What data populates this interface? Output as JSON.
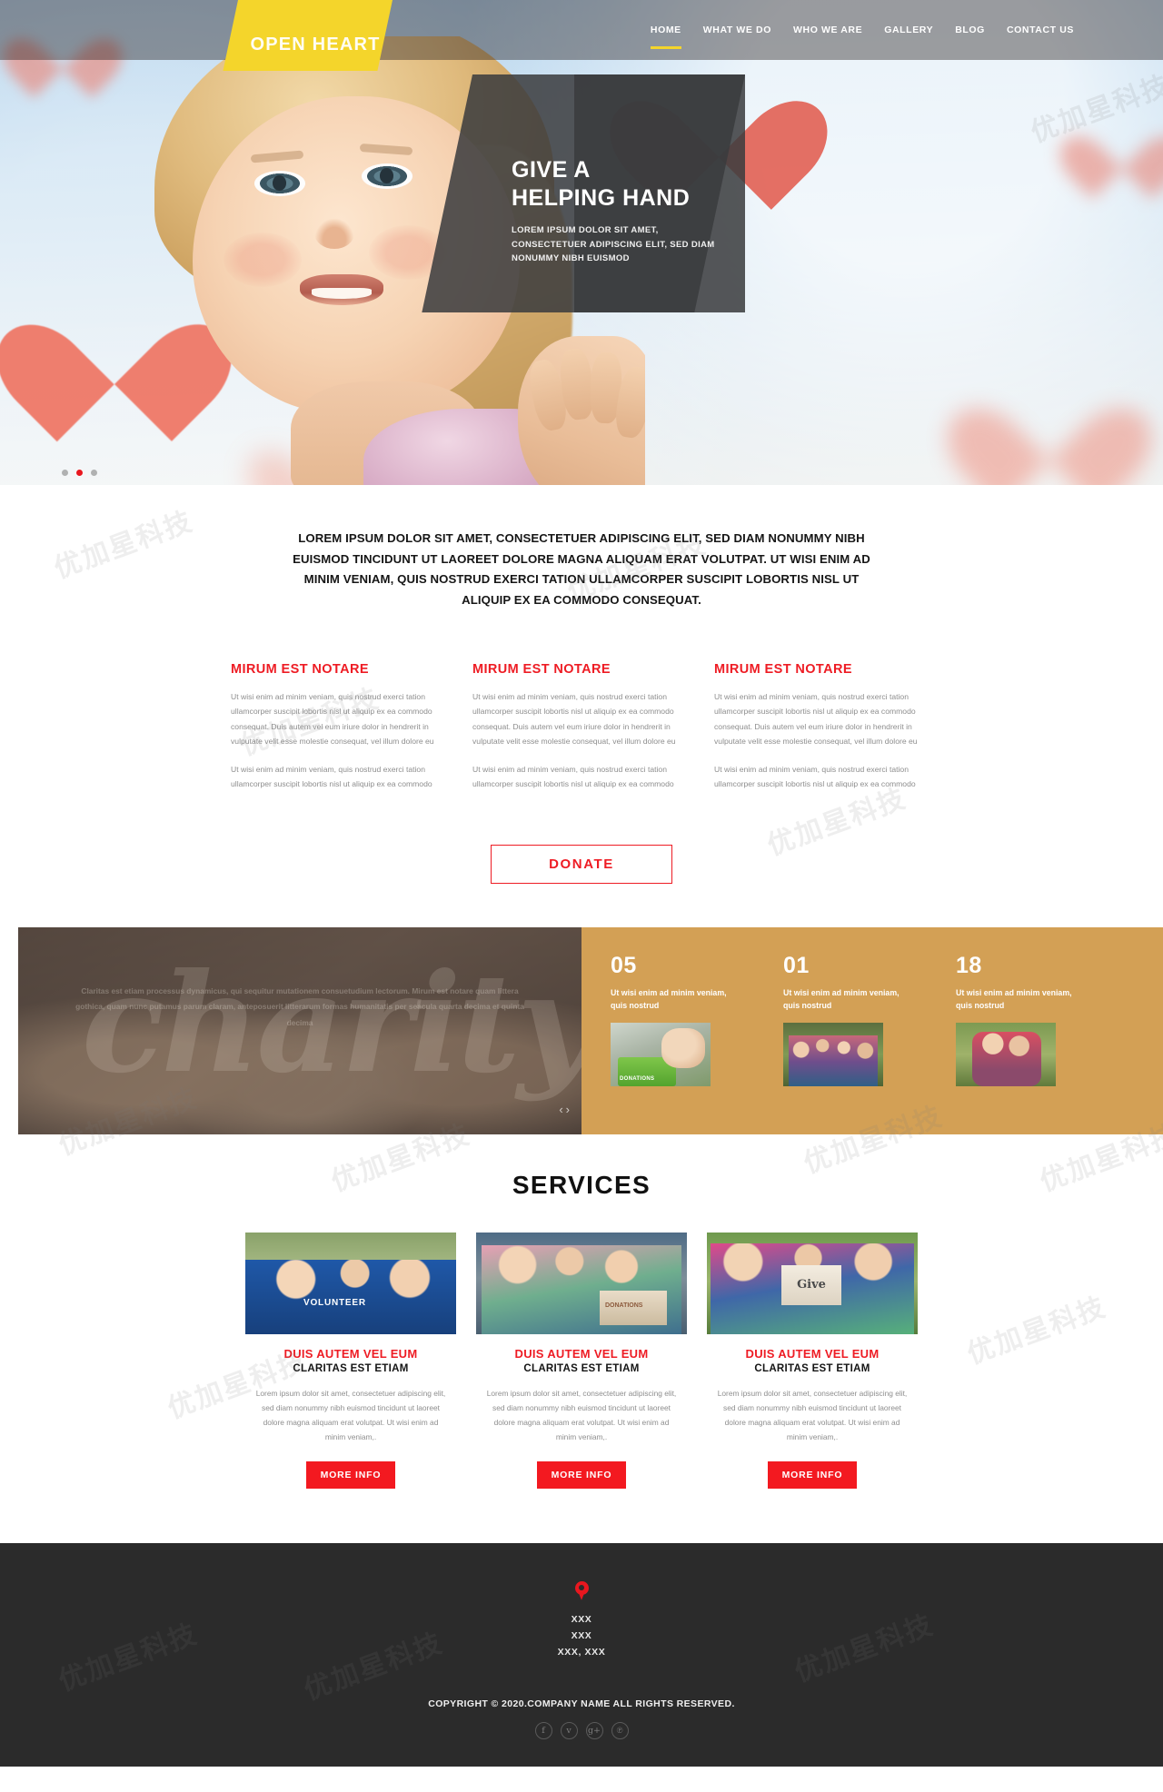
{
  "brand": {
    "name": "OPEN HEART",
    "heart_icon": "heart-icon",
    "logo_bg": "#F4D52B",
    "accent_red": "#EE1C24",
    "accent_gold": "#D3A055"
  },
  "nav": {
    "items": [
      {
        "label": "HOME",
        "active": true
      },
      {
        "label": "WHAT WE DO",
        "active": false
      },
      {
        "label": "WHO WE ARE",
        "active": false
      },
      {
        "label": "GALLERY",
        "active": false
      },
      {
        "label": "BLOG",
        "active": false
      },
      {
        "label": "CONTACT US",
        "active": false
      }
    ]
  },
  "hero": {
    "title_line1": "GIVE A",
    "title_line2": "HELPING HAND",
    "subtitle": "LOREM IPSUM DOLOR SIT AMET, CONSECTETUER ADIPISCING ELIT, SED DIAM NONUMMY NIBH EUISMOD",
    "slider_dots": 3,
    "active_dot_index": 1
  },
  "intro": {
    "text": "LOREM IPSUM DOLOR SIT AMET, CONSECTETUER ADIPISCING ELIT, SED DIAM NONUMMY NIBH EUISMOD TINCIDUNT UT LAOREET DOLORE MAGNA ALIQUAM ERAT VOLUTPAT. UT WISI ENIM AD MINIM VENIAM, QUIS NOSTRUD EXERCI TATION ULLAMCORPER SUSCIPIT LOBORTIS NISL UT ALIQUIP EX EA COMMODO CONSEQUAT."
  },
  "columns": [
    {
      "title": "MIRUM EST NOTARE",
      "para1": "Ut wisi enim ad minim veniam, quis nostrud exerci tation ullamcorper suscipit lobortis nisl ut aliquip ex ea commodo consequat. Duis autem vel eum iriure dolor in hendrerit in vulputate velit esse molestie consequat, vel illum dolore eu",
      "para2": "Ut wisi enim ad minim veniam, quis nostrud exerci tation ullamcorper suscipit lobortis nisl ut aliquip ex ea commodo"
    },
    {
      "title": "MIRUM EST NOTARE",
      "para1": "Ut wisi enim ad minim veniam, quis nostrud exerci tation ullamcorper suscipit lobortis nisl ut aliquip ex ea commodo consequat. Duis autem vel eum iriure dolor in hendrerit in vulputate velit esse molestie consequat, vel illum dolore eu",
      "para2": "Ut wisi enim ad minim veniam, quis nostrud exerci tation ullamcorper suscipit lobortis nisl ut aliquip ex ea commodo"
    },
    {
      "title": "MIRUM EST NOTARE",
      "para1": "Ut wisi enim ad minim veniam, quis nostrud exerci tation ullamcorper suscipit lobortis nisl ut aliquip ex ea commodo consequat. Duis autem vel eum iriure dolor in hendrerit in vulputate velit esse molestie consequat, vel illum dolore eu",
      "para2": "Ut wisi enim ad minim veniam, quis nostrud exerci tation ullamcorper suscipit lobortis nisl ut aliquip ex ea commodo"
    }
  ],
  "donate": {
    "label": "DONATE"
  },
  "quote_panel": {
    "background_word": "charity",
    "text": "Claritas est etiam processus dynamicus, qui sequitur mutationem consuetudium lectorum. Mirum est notare quam littera gothica, quam nunc putamus parum claram, anteposuerit litterarum formas humanitatis per seacula quarta decima et quinta decima",
    "prev_arrow": "‹",
    "next_arrow": "›"
  },
  "stats": [
    {
      "number": "05",
      "caption": "Ut wisi enim ad minim veniam, quis nostrud",
      "thumb": "donations-box-photo"
    },
    {
      "number": "01",
      "caption": "Ut wisi enim ad minim veniam, quis nostrud",
      "thumb": "family-group-photo"
    },
    {
      "number": "18",
      "caption": "Ut wisi enim ad minim veniam, quis nostrud",
      "thumb": "children-hug-photo"
    }
  ],
  "services": {
    "heading": "SERVICES",
    "cards": [
      {
        "title": "DUIS AUTEM VEL EUM",
        "subtitle": "CLARITAS EST ETIAM",
        "body": "Lorem ipsum dolor sit amet, consectetuer adipiscing elit, sed diam nonummy nibh euismod tincidunt ut laoreet dolore magna aliquam erat volutpat. Ut wisi enim ad minim veniam,.",
        "button": "MORE INFO",
        "image": "volunteer-team-photo",
        "image_tag": "VOLUNTEER"
      },
      {
        "title": "DUIS AUTEM VEL EUM",
        "subtitle": "CLARITAS EST ETIAM",
        "body": "Lorem ipsum dolor sit amet, consectetuer adipiscing elit, sed diam nonummy nibh euismod tincidunt ut laoreet dolore magna aliquam erat volutpat. Ut wisi enim ad minim veniam,.",
        "button": "MORE INFO",
        "image": "donations-handover-photo",
        "image_tag": "DONATIONS"
      },
      {
        "title": "DUIS AUTEM VEL EUM",
        "subtitle": "CLARITAS EST ETIAM",
        "body": "Lorem ipsum dolor sit amet, consectetuer adipiscing elit, sed diam nonummy nibh euismod tincidunt ut laoreet dolore magna aliquam erat volutpat. Ut wisi enim ad minim veniam,.",
        "button": "MORE INFO",
        "image": "children-give-sign-photo",
        "image_tag": "Give"
      }
    ]
  },
  "footer": {
    "pin_icon": "map-pin-icon",
    "address_lines": [
      "XXX",
      "XXX",
      "XXX, XXX"
    ],
    "copyright": "COPYRIGHT © 2020.COMPANY NAME ALL RIGHTS RESERVED.",
    "socials": [
      {
        "name": "facebook-icon",
        "glyph": "f"
      },
      {
        "name": "twitter-icon",
        "glyph": "ᴠ"
      },
      {
        "name": "google-plus-icon",
        "glyph": "g+"
      },
      {
        "name": "pinterest-icon",
        "glyph": "℗"
      }
    ]
  },
  "watermark": {
    "text": "优加星科技"
  }
}
